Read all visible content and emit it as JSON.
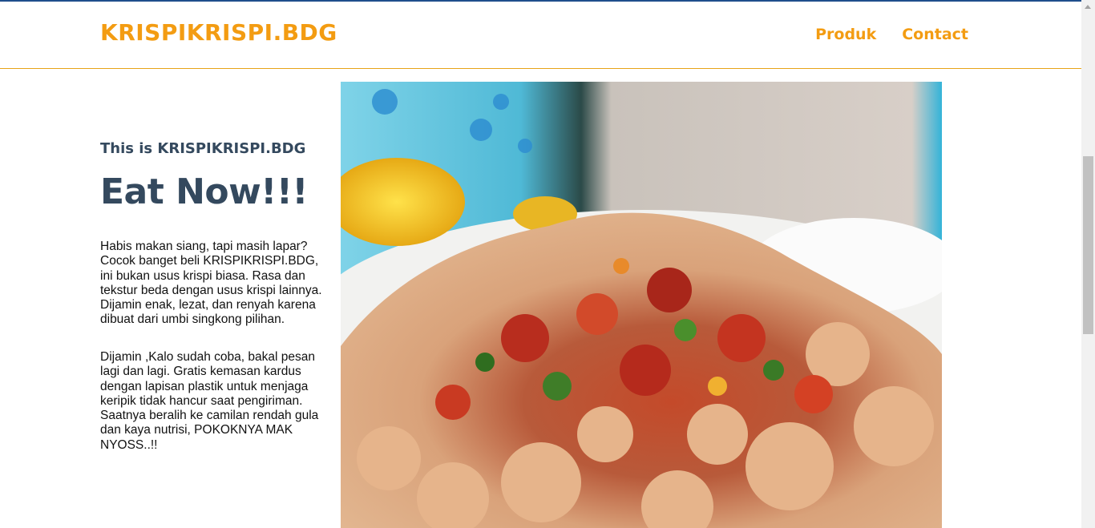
{
  "header": {
    "brand": "KRISPIKRISPI.BDG",
    "nav": [
      "Produk",
      "Contact"
    ]
  },
  "hero": {
    "subtitle": "This is KRISPIKRISPI.BDG",
    "title": "Eat Now!!!",
    "paragraph1": "Habis makan siang, tapi masih lapar? Cocok banget beli KRISPIKRISPI.BDG, ini bukan usus krispi biasa. Rasa dan tekstur beda dengan usus krispi lainnya. Dijamin enak, lezat, dan renyah karena dibuat dari umbi singkong pilihan.",
    "paragraph2": "Dijamin ,Kalo sudah coba, bakal pesan lagi dan lagi. Gratis kemasan kardus dengan lapisan plastik untuk menjaga keripik tidak hancur saat pengiriman. Saatnya beralih ke camilan rendah gula dan kaya nutrisi, POKOKNYA MAK NYOSS..!!",
    "image_icon": "food-photo-icon"
  },
  "colors": {
    "brand": "#f39c12",
    "heading": "#34495e",
    "header_border": "#e8a317"
  }
}
